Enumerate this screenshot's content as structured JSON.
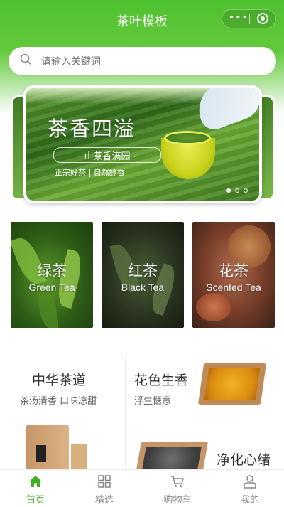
{
  "nav": {
    "title": "茶叶模板",
    "capsule_more": "•••"
  },
  "search": {
    "placeholder": "请输入关键词"
  },
  "banner": {
    "title": "茶香四溢",
    "subtitle": "· 山茶香满园 ·",
    "tagline": "正宗好茶 | 自然醇香",
    "dots": 3,
    "active_dot": 1
  },
  "categories": [
    {
      "name": "绿茶",
      "en": "Green Tea"
    },
    {
      "name": "红茶",
      "en": "Black Tea"
    },
    {
      "name": "花茶",
      "en": "Scented Tea"
    }
  ],
  "features": {
    "left": {
      "title": "中华茶道",
      "subtitle": "茶汤清香  口味凉甜"
    },
    "right_top": {
      "title": "花色生香",
      "subtitle": "浮生惬意"
    },
    "right_bottom": {
      "title": "净化心绪"
    }
  },
  "tabbar": {
    "items": [
      {
        "label": "首页",
        "icon": "home-icon"
      },
      {
        "label": "精选",
        "icon": "grid-icon"
      },
      {
        "label": "购物车",
        "icon": "cart-icon"
      },
      {
        "label": "我的",
        "icon": "user-icon"
      }
    ],
    "active_index": 0
  },
  "colors": {
    "brand": "#4cbf2b",
    "tab_active": "#3fae22",
    "tab_inactive": "#888888"
  }
}
